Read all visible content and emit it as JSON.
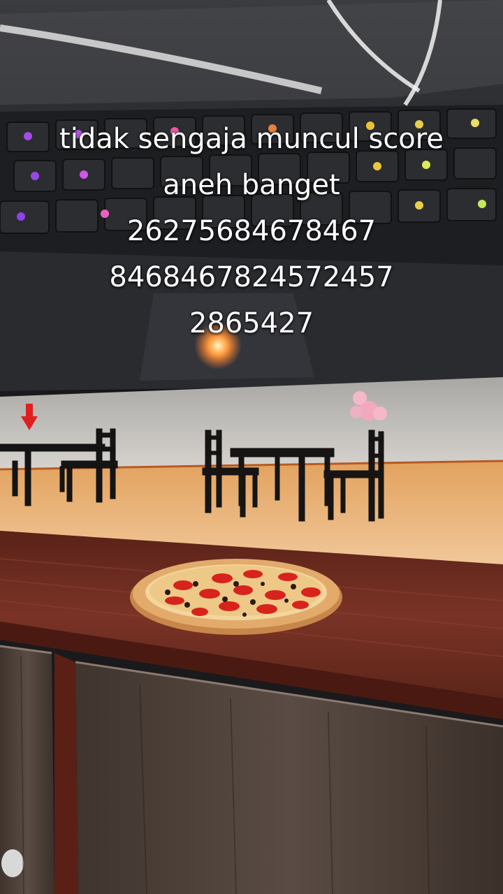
{
  "caption": {
    "lines": [
      "tidak sengaja muncul score",
      "aneh banget",
      "26275684678467",
      "846846782457245​7",
      "2865427"
    ]
  },
  "scene": {
    "marker_icon": "red-down-arrow-icon",
    "food_item": "pepperoni-pizza",
    "colors": {
      "marker": "#e02020",
      "floor": "#d9a56a",
      "counter": "#6e2a1e"
    }
  }
}
